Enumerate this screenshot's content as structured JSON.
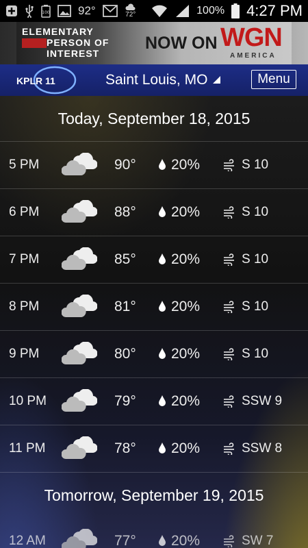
{
  "status_bar": {
    "temp": "92°",
    "weather_temp": "72°",
    "battery": "100%",
    "time": "4:27 PM",
    "icons": [
      "plus-icon",
      "usb-icon",
      "battery-saver-icon",
      "image-icon",
      "mail-icon",
      "weather-icon",
      "wifi-icon",
      "signal-icon",
      "battery-icon"
    ]
  },
  "ad": {
    "line1": "ELEMENTARY",
    "line2": "PERSON OF",
    "line3": "INTEREST",
    "cta": "NOW ON",
    "brand": "WGN",
    "brand_sub": "AMERICA"
  },
  "header": {
    "logo": "KPLR 11",
    "location": "Saint Louis, MO",
    "menu_label": "Menu"
  },
  "today": {
    "title": "Today, September 18, 2015",
    "rows": [
      {
        "time": "5 PM",
        "temp": "90°",
        "precip": "20%",
        "wind": "S 10"
      },
      {
        "time": "6 PM",
        "temp": "88°",
        "precip": "20%",
        "wind": "S 10"
      },
      {
        "time": "7 PM",
        "temp": "85°",
        "precip": "20%",
        "wind": "S 10"
      },
      {
        "time": "8 PM",
        "temp": "81°",
        "precip": "20%",
        "wind": "S 10"
      },
      {
        "time": "9 PM",
        "temp": "80°",
        "precip": "20%",
        "wind": "S 10"
      },
      {
        "time": "10 PM",
        "temp": "79°",
        "precip": "20%",
        "wind": "SSW 9"
      },
      {
        "time": "11 PM",
        "temp": "78°",
        "precip": "20%",
        "wind": "SSW 8"
      }
    ]
  },
  "tomorrow": {
    "title": "Tomorrow, September 19, 2015",
    "rows": [
      {
        "time": "12 AM",
        "temp": "77°",
        "precip": "20%",
        "wind": "SW 7"
      }
    ]
  },
  "icons": {
    "condition": "partly-cloudy-icon",
    "precip": "raindrop-icon",
    "wind": "wind-icon"
  }
}
